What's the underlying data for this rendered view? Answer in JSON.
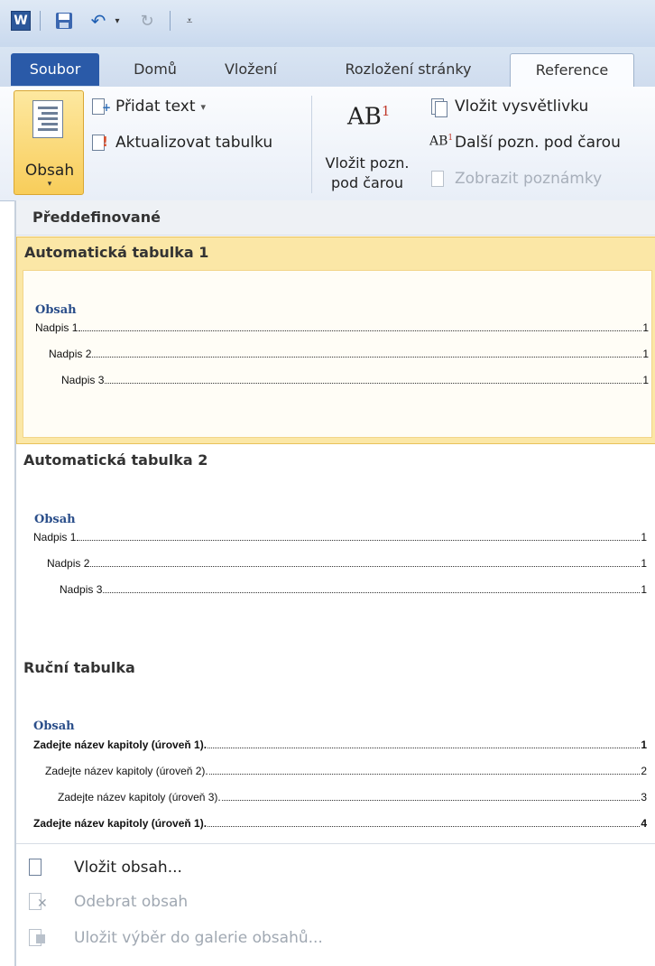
{
  "qat": {
    "app_icon": "W",
    "icons": [
      "word-logo-icon",
      "save-icon",
      "undo-icon",
      "dropdown-arrow-icon",
      "redo-icon",
      "customize-toolbar-icon"
    ],
    "undo_glyph": "↶",
    "undo_drop": "▾",
    "redo_glyph": "↻",
    "customize_glyph": "⩡"
  },
  "tabs": {
    "file": "Soubor",
    "home": "Domů",
    "insert": "Vložení",
    "layout": "Rozložení stránky",
    "references": "Reference"
  },
  "ribbon": {
    "toc_label": "Obsah",
    "toc_arrow": "▾",
    "add_text": "Přidat text",
    "add_text_arrow": "▾",
    "update_table": "Aktualizovat tabulku",
    "footnote_icon_text": "AB",
    "footnote_icon_sup": "1",
    "insert_footnote_line1": "Vložit pozn.",
    "insert_footnote_line2": "pod čarou",
    "insert_endnote": "Vložit vysvětlivku",
    "next_footnote_ab": "AB",
    "next_footnote_sup": "1",
    "next_footnote": "Další pozn. pod čarou",
    "show_notes": "Zobrazit poznámky"
  },
  "gallery": {
    "header": "Předdefinované",
    "sections": [
      {
        "title": "Automatická tabulka 1",
        "preview_title": "Obsah",
        "entries": [
          {
            "text": "Nadpis 1",
            "page": "1"
          },
          {
            "text": "Nadpis 2",
            "page": "1"
          },
          {
            "text": "Nadpis 3",
            "page": "1"
          }
        ]
      },
      {
        "title": "Automatická tabulka 2",
        "preview_title": "Obsah",
        "entries": [
          {
            "text": "Nadpis 1",
            "page": "1"
          },
          {
            "text": "Nadpis 2",
            "page": "1"
          },
          {
            "text": "Nadpis 3",
            "page": "1"
          }
        ]
      },
      {
        "title": "Ruční tabulka",
        "preview_title": "Obsah",
        "entries": [
          {
            "text": "Zadejte název kapitoly (úroveň 1).",
            "page": "1"
          },
          {
            "text": "Zadejte název kapitoly (úroveň 2).",
            "page": "2"
          },
          {
            "text": "Zadejte název kapitoly (úroveň 3).",
            "page": "3"
          },
          {
            "text": "Zadejte název kapitoly (úroveň 1).",
            "page": "4"
          }
        ]
      }
    ],
    "menu": [
      {
        "label": "Vložit obsah...",
        "enabled": true
      },
      {
        "label": "Odebrat obsah",
        "enabled": false
      },
      {
        "label": "Uložit výběr do galerie obsahů...",
        "enabled": false
      }
    ]
  },
  "colors": {
    "file_tab": "#2a5aa8",
    "selected_highlight": "#fbe7a6",
    "preview_title": "#2a4e8a"
  }
}
